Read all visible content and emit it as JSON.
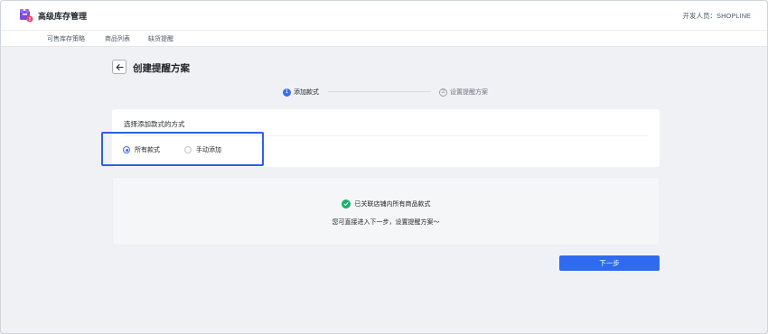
{
  "app": {
    "title": "高级库存管理",
    "developer": "开发人员：SHOPLINE",
    "logo_icon": "inventory-box-icon",
    "accent": "#3b6cf2"
  },
  "subnav": {
    "tabs": [
      {
        "label": "可售库存策略"
      },
      {
        "label": "商品列表"
      },
      {
        "label": "缺货提醒"
      }
    ]
  },
  "page": {
    "back_icon": "arrow-left-icon",
    "title": "创建提醒方案"
  },
  "steps": [
    {
      "number": "1",
      "label": "添加款式",
      "state": "active"
    },
    {
      "number": "2",
      "label": "设置提醒方案",
      "state": "pending"
    }
  ],
  "method_card": {
    "title": "选择添加款式的方式",
    "options": [
      {
        "label": "所有款式",
        "checked": true
      },
      {
        "label": "手动添加",
        "checked": false
      }
    ]
  },
  "info_panel": {
    "status_icon": "check-circle-icon",
    "status_color": "#17b26a",
    "line1": "已关联店铺内所有商品款式",
    "line2": "您可直接进入下一步，设置提醒方案～"
  },
  "actions": {
    "next_label": "下一步",
    "next_color": "#2f6bf0"
  }
}
